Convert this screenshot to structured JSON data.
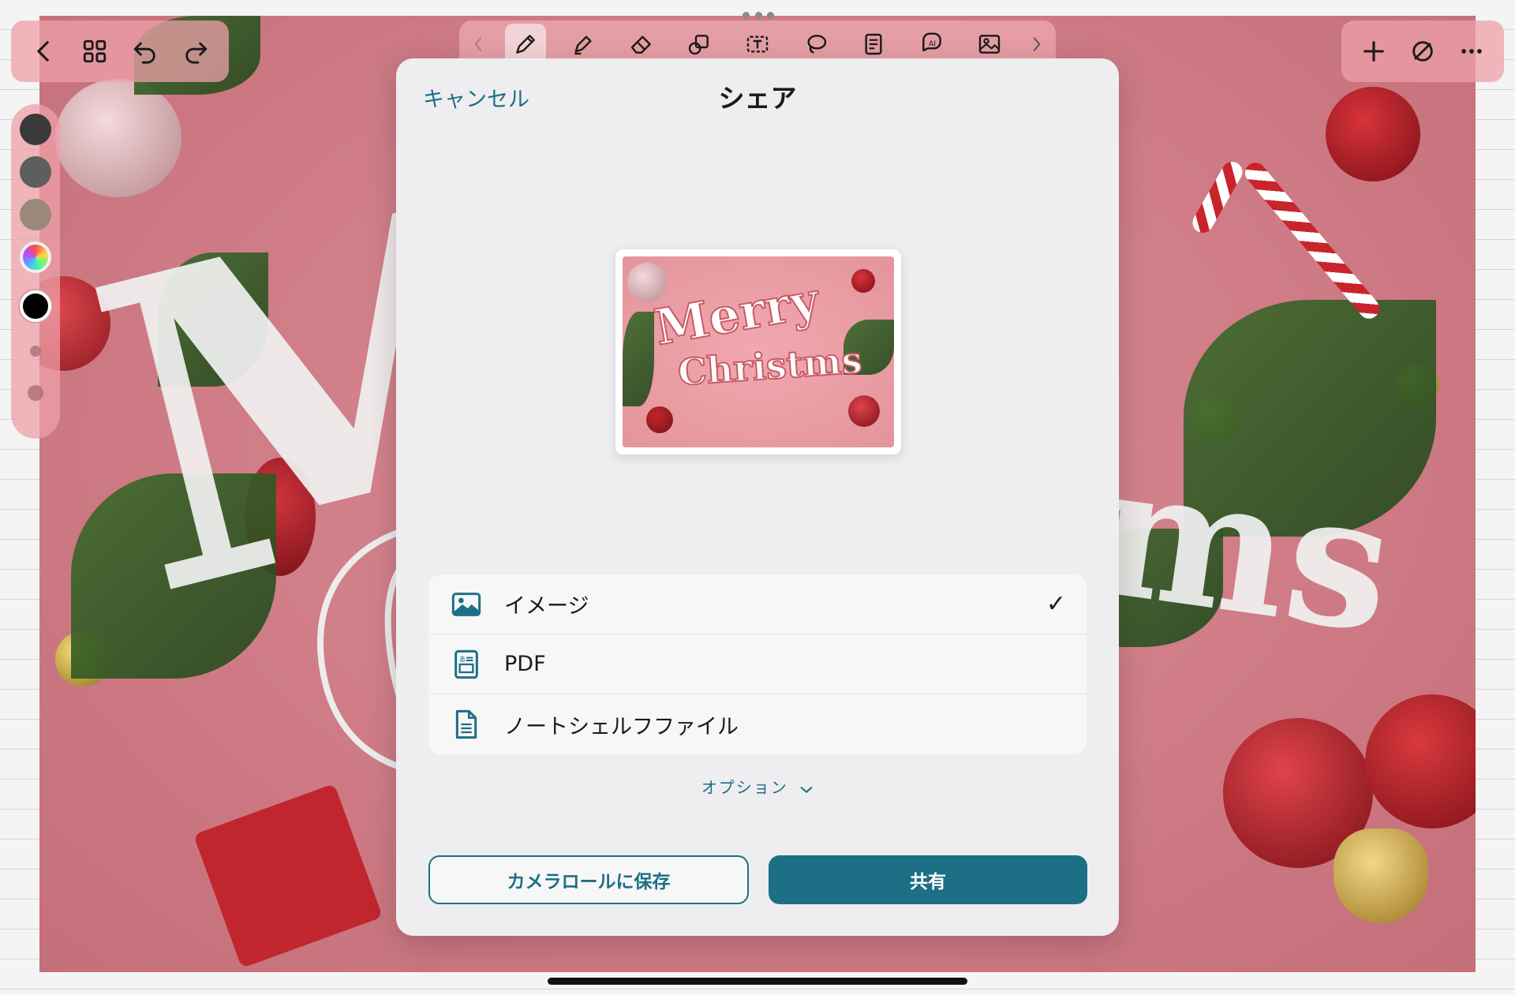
{
  "toolbar_left": {
    "icons": [
      "chevron-left-icon",
      "grid-icon",
      "undo-icon",
      "redo-icon"
    ]
  },
  "toolbar_center": {
    "tools": [
      "pen-icon",
      "highlighter-icon",
      "eraser-icon",
      "shapes-icon",
      "text-box-icon",
      "lasso-icon",
      "sticky-note-icon",
      "ai-assistant-icon",
      "image-icon"
    ],
    "active_tool": "pen-icon"
  },
  "toolbar_right": {
    "icons": [
      "plus-icon",
      "no-pen-icon",
      "more-icon"
    ]
  },
  "palette": {
    "colors": [
      "#3a3a3a",
      "#5e5e5e",
      "#9a8878",
      "multicolor",
      "#000000"
    ],
    "selected": "#000000"
  },
  "preview": {
    "text_line1": "Merry",
    "text_line2": "Christms"
  },
  "share_dialog": {
    "cancel_label": "キャンセル",
    "title": "シェア",
    "options": [
      {
        "label": "イメージ",
        "icon": "image-icon",
        "selected": true
      },
      {
        "label": "PDF",
        "icon": "pdf-document-icon",
        "selected": false
      },
      {
        "label": "ノートシェルフファイル",
        "icon": "file-icon",
        "selected": false
      }
    ],
    "check_mark": "✓",
    "options_toggle_label": "オプション",
    "save_button_label": "カメラロールに保存",
    "share_button_label": "共有"
  },
  "colors": {
    "accent": "#1d6f86",
    "modal_bg": "#eeeef0",
    "photo_bg": "#cf7c86"
  }
}
